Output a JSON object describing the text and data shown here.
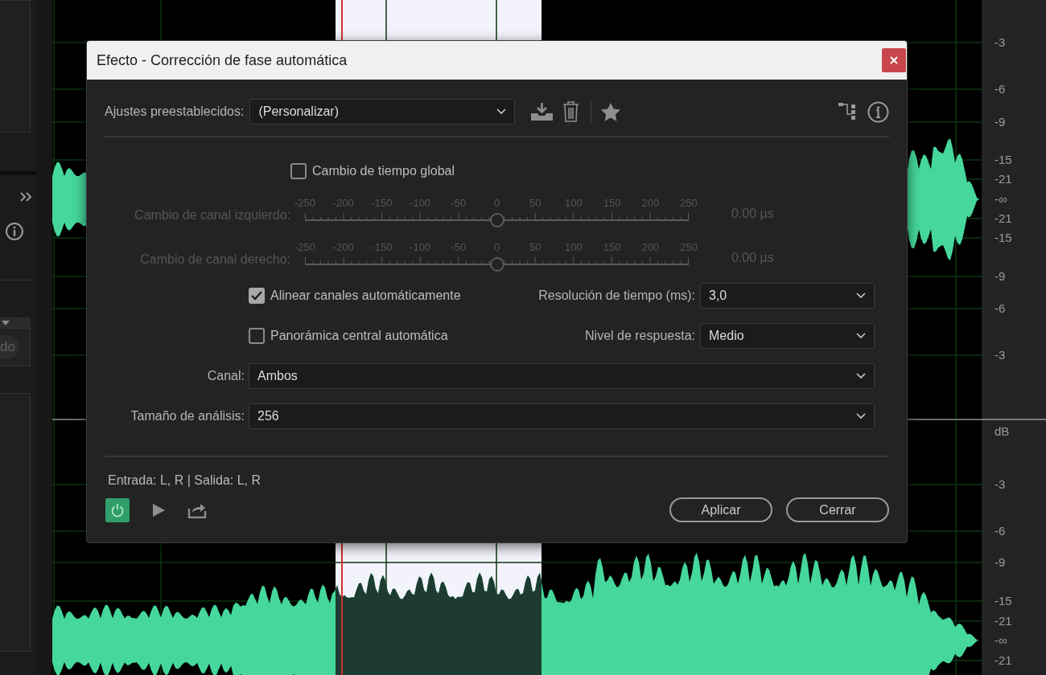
{
  "editor": {
    "left_panel": {
      "field_text": "do"
    },
    "db_ruler": {
      "top_labels": [
        "-3",
        "-6",
        "-9",
        "-15",
        "-21",
        "-∞",
        "-21",
        "-15",
        "-9",
        "-6",
        "-3"
      ],
      "unit": "dB",
      "bottom_labels": [
        "-3",
        "-6",
        "-9",
        "-15",
        "-21",
        "-∞",
        "-21"
      ]
    }
  },
  "dialog": {
    "title": "Efecto - Corrección de fase automática",
    "presets": {
      "label": "Ajustes preestablecidos:",
      "value": "(Personalizar)"
    },
    "global_time_shift": {
      "label": "Cambio de tiempo global",
      "checked": false
    },
    "channel_shifts": [
      {
        "label": "Cambio de canal izquierdo:",
        "ticks": [
          "-250",
          "-200",
          "-150",
          "-100",
          "-50",
          "0",
          "50",
          "100",
          "150",
          "200",
          "250"
        ],
        "level": 0.5,
        "reading": "0.00 µs",
        "disabled": true
      },
      {
        "label": "Cambio de canal derecho:",
        "ticks": [
          "-250",
          "-200",
          "-150",
          "-100",
          "-50",
          "0",
          "50",
          "100",
          "150",
          "200",
          "250"
        ],
        "level": 0.5,
        "reading": "0.00 µs",
        "disabled": true
      }
    ],
    "option_rows": [
      {
        "checkbox": {
          "label": "Alinear canales automáticamente",
          "checked": true
        },
        "field": {
          "label": "Resolución de tiempo (ms):",
          "value": "3,0"
        }
      },
      {
        "checkbox": {
          "label": "Panorámica central automática",
          "checked": false
        },
        "field": {
          "label": "Nivel de respuesta:",
          "value": "Medio"
        }
      }
    ],
    "wide_fields": [
      {
        "label": "Canal:",
        "value": "Ambos"
      },
      {
        "label": "Tamaño de análisis:",
        "value": "256"
      }
    ],
    "io_text": "Entrada: L, R | Salida: L, R",
    "power": {
      "on": true
    },
    "buttons": [
      "Aplicar",
      "Cerrar"
    ]
  }
}
